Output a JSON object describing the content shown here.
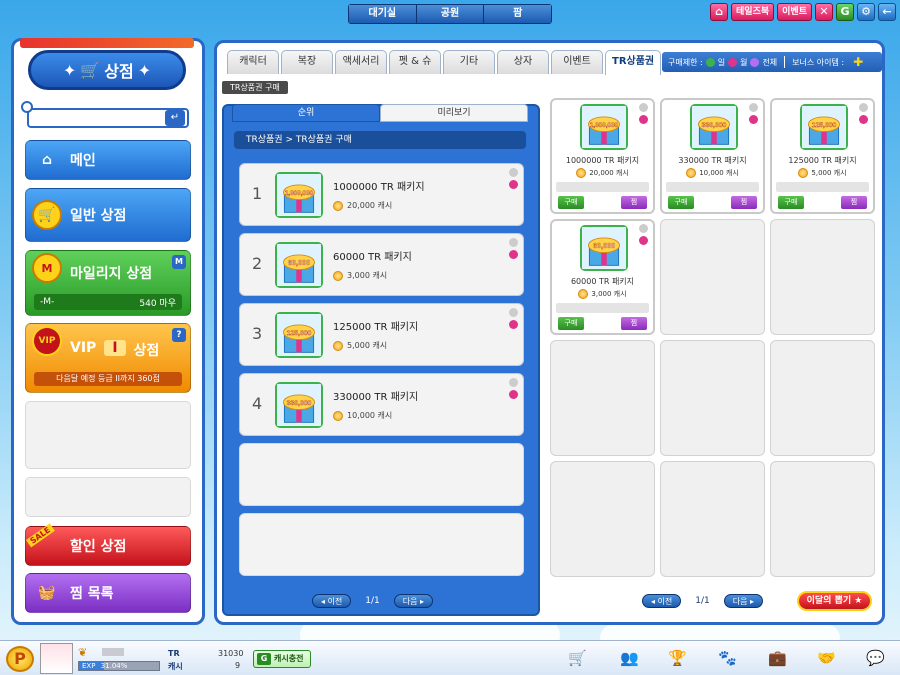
{
  "nav": {
    "tabs": [
      "대기실",
      "공원",
      "팜"
    ]
  },
  "top_right": {
    "buttons": [
      "테일즈북",
      "이벤트"
    ],
    "icons": [
      "close-icon",
      "g-icon",
      "settings-icon",
      "back-icon"
    ]
  },
  "sidebar": {
    "title": "상점",
    "menu": [
      {
        "label": "메인"
      },
      {
        "label": "일반 상점"
      },
      {
        "label": "마일리지 상점",
        "mileage_value": "540 마우"
      },
      {
        "label_vip": "VIP",
        "label_level": "I",
        "label_shop": "상점",
        "next_grade": "다음달 예정 등급 II까지 360점"
      },
      {
        "label": "할인 상점",
        "badge": "SALE"
      },
      {
        "label": "찜 목록"
      }
    ]
  },
  "tabs": [
    "캐릭터",
    "복장",
    "액세서리",
    "펫 & 슈",
    "기타",
    "상자",
    "이벤트",
    "TR상품권"
  ],
  "active_tab": "TR상품권",
  "limit_bar": {
    "label": "구매제한 :",
    "opt1": "일",
    "opt2": "월",
    "opt3": "전체",
    "bonus": "보너스 아이템 :"
  },
  "crumb_tag": "TR상품권 구매",
  "subtabs": [
    "순위",
    "미리보기"
  ],
  "rank_breadcrumb": "TR상품권 > TR상품권 구매",
  "ranking": [
    {
      "rank": "1",
      "title": "1000000 TR 패키지",
      "price": "20,000 캐시",
      "box_label": "1,000,000"
    },
    {
      "rank": "2",
      "title": "60000 TR 패키지",
      "price": "3,000 캐시",
      "box_label": "60,000"
    },
    {
      "rank": "3",
      "title": "125000 TR 패키지",
      "price": "5,000 캐시",
      "box_label": "125,000"
    },
    {
      "rank": "4",
      "title": "330000 TR 패키지",
      "price": "10,000 캐시",
      "box_label": "330,000"
    }
  ],
  "rank_pager": {
    "prev": "이전",
    "page": "1/1",
    "next": "다음"
  },
  "items": [
    {
      "name": "1000000 TR 패키지",
      "price": "20,000 캐시",
      "box_label": "1,000,000"
    },
    {
      "name": "330000 TR 패키지",
      "price": "10,000 캐시",
      "box_label": "330,000"
    },
    {
      "name": "125000 TR 패키지",
      "price": "5,000 캐시",
      "box_label": "125,000"
    },
    {
      "name": "60000 TR 패키지",
      "price": "3,000 캐시",
      "box_label": "60,000"
    }
  ],
  "item_buttons": {
    "buy": "구매",
    "wish": "찜"
  },
  "item_pager": {
    "prev": "이전",
    "page": "1/1",
    "next": "다음"
  },
  "month_pick": "이달의 뽑기",
  "bottom": {
    "exp_label": "EXP",
    "exp_value": "31.04%",
    "exp_fraction": 0.3104,
    "tr_label": "TR",
    "tr_value": "31030",
    "cash_label": "캐시",
    "cash_value": "9",
    "charge_label": "캐시충전",
    "icons": [
      "cart-icon",
      "friends-icon",
      "trophy-icon",
      "paw-icon",
      "briefcase-icon",
      "handshake-icon",
      "chat-icon"
    ]
  },
  "colors": {
    "primary_blue": "#2b68c6",
    "pink": "#e0348a",
    "green": "#3bb24a",
    "red": "#c4121b"
  }
}
